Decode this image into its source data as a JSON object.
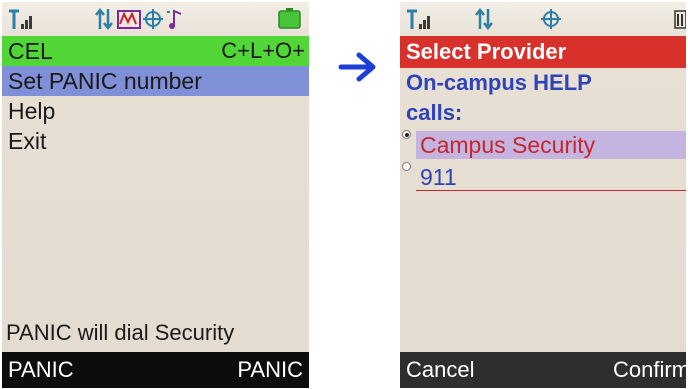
{
  "left_screen": {
    "menu": [
      {
        "label": "CEL",
        "shortcut": "C+L+O+"
      },
      {
        "label": "Set PANIC number"
      },
      {
        "label": "Help"
      },
      {
        "label": "Exit"
      }
    ],
    "status_message": "PANIC will dial Security",
    "softkeys": {
      "left": "PANIC",
      "right": "PANIC"
    }
  },
  "right_screen": {
    "title": "Select Provider",
    "prompt_line1": "On-campus HELP",
    "prompt_line2": "calls:",
    "options": [
      {
        "label": "Campus Security",
        "selected": true
      },
      {
        "label": "911",
        "selected": false
      }
    ],
    "softkeys": {
      "left": "Cancel",
      "right": "Confirm"
    }
  },
  "icons": {
    "signal": "signal-strength-icon",
    "data": "data-transfer-icon",
    "message": "voicemail-icon",
    "gps": "gps-crosshair-icon",
    "music": "music-note-icon",
    "battery": "battery-icon",
    "arrow": "right-arrow-icon"
  },
  "colors": {
    "green_highlight": "#52d637",
    "selection_blue": "#7f8fd8",
    "title_red": "#d8302a",
    "prompt_blue": "#2f44b6",
    "option_red": "#c4282f",
    "option_highlight": "#c5b4df",
    "arrow_blue": "#1c3fd8"
  }
}
